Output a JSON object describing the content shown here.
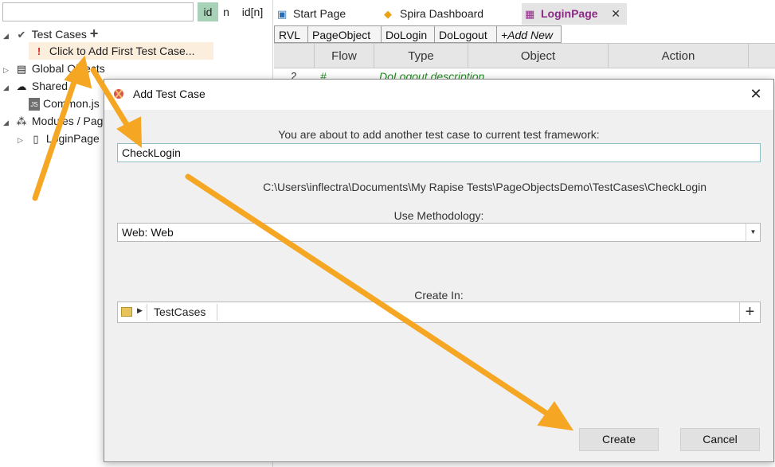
{
  "tree": {
    "search_value": "",
    "filters": {
      "id": "id",
      "n": "n",
      "id_n": "id[n]"
    },
    "test_cases": "Test Cases",
    "add_first": "Click to Add First Test Case...",
    "global_objects": "Global Objects",
    "shared": "Shared",
    "common_js": "Common.js",
    "modules": "Modules / Pages",
    "login_page": "LoginPage"
  },
  "tabs": {
    "start_page": "Start Page",
    "spira_dashboard": "Spira Dashboard",
    "login_page": "LoginPage"
  },
  "sheets": [
    "RVL",
    "PageObject",
    "DoLogin",
    "DoLogout",
    "+Add New"
  ],
  "grid": {
    "columns": [
      "Flow",
      "Type",
      "Object",
      "Action"
    ],
    "row_number": "2",
    "row_flow": "#",
    "row_type": "DoLogout description"
  },
  "dialog": {
    "title": "Add Test Case",
    "prompt": "You are about to add another test case to current test framework:",
    "test_name": "CheckLogin",
    "path": "C:\\Users\\inflectra\\Documents\\My  Rapise  Tests\\PageObjectsDemo\\TestCases\\CheckLogin",
    "methodology_label": "Use Methodology:",
    "methodology_value": "Web: Web",
    "create_in_label": "Create In:",
    "create_in_folder": "TestCases",
    "create_button": "Create",
    "cancel_button": "Cancel"
  },
  "colors": {
    "accent_purple": "#8b2a84",
    "arrow_orange": "#f5a623",
    "filter_green": "#a6d3b7",
    "error_red": "#e01e1e"
  }
}
